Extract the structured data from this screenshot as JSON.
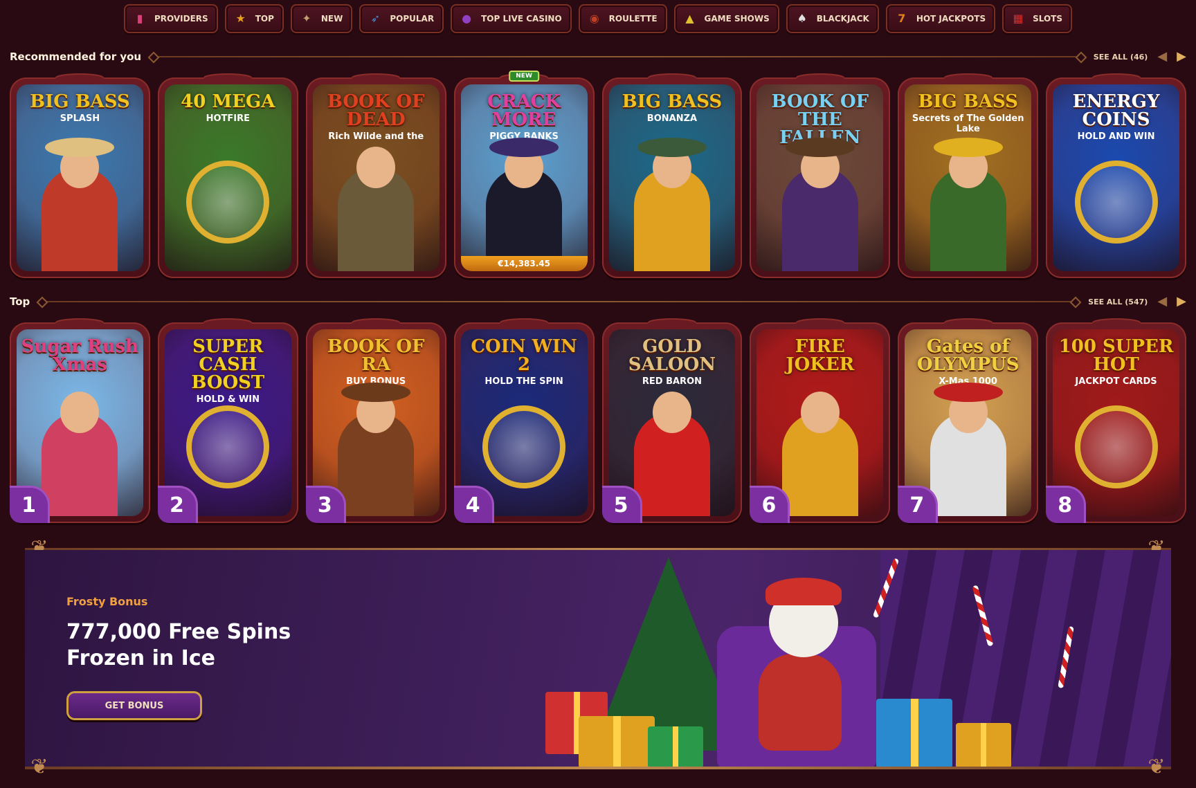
{
  "nav": [
    {
      "label": "Providers",
      "icon": "providers-icon",
      "glyph": "▮",
      "color": "#d8407a"
    },
    {
      "label": "Top",
      "icon": "trophy-icon",
      "glyph": "★",
      "color": "#e8a020"
    },
    {
      "label": "New",
      "icon": "magic-hat-icon",
      "glyph": "✦",
      "color": "#c0a070"
    },
    {
      "label": "Popular",
      "icon": "rocket-icon",
      "glyph": "➶",
      "color": "#4a8ad0"
    },
    {
      "label": "Top Live Casino",
      "icon": "live-casino-icon",
      "glyph": "●",
      "color": "#9040c0"
    },
    {
      "label": "Roulette",
      "icon": "roulette-icon",
      "glyph": "◉",
      "color": "#c04020"
    },
    {
      "label": "Game Shows",
      "icon": "microphone-icon",
      "glyph": "▲",
      "color": "#e0c030"
    },
    {
      "label": "Blackjack",
      "icon": "cards-icon",
      "glyph": "♠",
      "color": "#e0e0e0"
    },
    {
      "label": "Hot Jackpots",
      "icon": "jackpot-77-icon",
      "glyph": "7",
      "color": "#e08020"
    },
    {
      "label": "Slots",
      "icon": "slot-machine-icon",
      "glyph": "▦",
      "color": "#d03030"
    }
  ],
  "recommended": {
    "title": "Recommended for you",
    "see_all": "SEE ALL (46)",
    "games": [
      {
        "title": "BIG BASS",
        "sub": "SPLASH",
        "bg": "#3a7ab0",
        "title_color": "#f0c020",
        "fig": "#c03a2a",
        "hat": "#e0c080"
      },
      {
        "title": "40 MEGA",
        "sub": "HOTFIRE",
        "bg": "#3a7a2a",
        "title_color": "#f0d020",
        "fig": "",
        "hat": ""
      },
      {
        "title": "BOOK OF DEAD",
        "sub": "Rich Wilde and the",
        "bg": "#7a5020",
        "title_color": "#e04020",
        "fig": "#6a5a3a",
        "hat": ""
      },
      {
        "title": "CRACK MORE",
        "sub": "PIGGY BANKS",
        "bg": "#5aa0d0",
        "title_color": "#e040a0",
        "fig": "#1a1a2a",
        "hat": "#3a2a6a",
        "badge": "NEW",
        "jackpot": "€14,383.45"
      },
      {
        "title": "BIG BASS",
        "sub": "BONANZA",
        "bg": "#1a6a8a",
        "title_color": "#f0c020",
        "fig": "#e0a020",
        "hat": "#3a5a3a"
      },
      {
        "title": "BOOK OF THE FALLEN",
        "sub": "",
        "bg": "#6a4a3a",
        "title_color": "#7ad0f0",
        "fig": "#4a2a6a",
        "hat": "#5a3a20"
      },
      {
        "title": "BIG BASS",
        "sub": "Secrets of The Golden Lake",
        "bg": "#a07020",
        "title_color": "#f0c020",
        "fig": "#3a6a2a",
        "hat": "#e0b020"
      },
      {
        "title": "ENERGY COINS",
        "sub": "HOLD AND WIN",
        "bg": "#1a4ab0",
        "title_color": "#ffffff",
        "fig": "",
        "hat": ""
      }
    ]
  },
  "top": {
    "title": "Top",
    "see_all": "SEE ALL (547)",
    "games": [
      {
        "rank": "1",
        "title": "Sugar Rush Xmas",
        "sub": "",
        "bg": "#7ab8e8",
        "title_color": "#e04080",
        "fig": "#d04060",
        "hat": ""
      },
      {
        "rank": "2",
        "title": "SUPER CASH BOOST",
        "sub": "HOLD & WIN",
        "bg": "#3a1a8a",
        "title_color": "#f0d020",
        "fig": "",
        "hat": ""
      },
      {
        "rank": "3",
        "title": "BOOK OF RA",
        "sub": "BUY BONUS",
        "bg": "#d06020",
        "title_color": "#f0c030",
        "fig": "#7a4020",
        "hat": "#6a3a1a"
      },
      {
        "rank": "4",
        "title": "COIN WIN 2",
        "sub": "HOLD THE SPIN",
        "bg": "#1a2a7a",
        "title_color": "#f0b020",
        "fig": "",
        "hat": ""
      },
      {
        "rank": "5",
        "title": "GOLD SALOON",
        "sub": "RED BARON",
        "bg": "#2a2a3a",
        "title_color": "#e0c080",
        "fig": "#d02020",
        "hat": ""
      },
      {
        "rank": "6",
        "title": "FIRE JOKER",
        "sub": "",
        "bg": "#b01a1a",
        "title_color": "#f0c020",
        "fig": "#e0a020",
        "hat": ""
      },
      {
        "rank": "7",
        "title": "Gates of OLYMPUS",
        "sub": "X-Mas 1000",
        "bg": "#d0a050",
        "title_color": "#f0d040",
        "fig": "#e0e0e0",
        "hat": "#c02020"
      },
      {
        "rank": "8",
        "title": "100 SUPER HOT",
        "sub": "JACKPOT CARDS",
        "bg": "#a01a1a",
        "title_color": "#f0c020",
        "fig": "",
        "hat": ""
      }
    ]
  },
  "banner": {
    "eyebrow": "Frosty Bonus",
    "title_line1": "777,000 Free Spins",
    "title_line2": "Frozen in Ice",
    "button": "GET BONUS"
  },
  "colors": {
    "background": "#2a0a12",
    "card": "#6a1a22",
    "accent": "#f0a040",
    "rank_badge": "#7b2fa0"
  }
}
